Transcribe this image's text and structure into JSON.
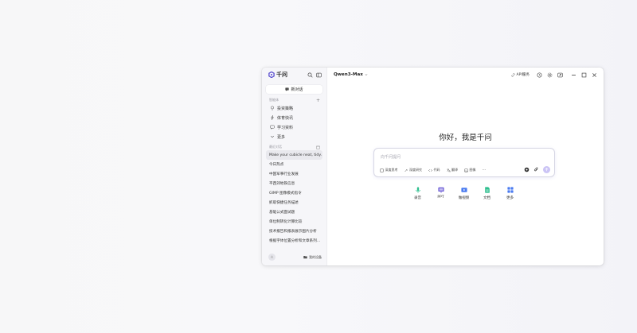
{
  "app": {
    "logo_text": "千问"
  },
  "sidebar": {
    "new_chat": "新对话",
    "agents_header": "智能体",
    "agents": [
      {
        "label": "投资策略",
        "icon": "lightbulb-icon"
      },
      {
        "label": "体育快讯",
        "icon": "lightning-icon"
      },
      {
        "label": "学习资料",
        "icon": "chat-bubble-icon"
      },
      {
        "label": "更多",
        "icon": "chevron-down-icon"
      }
    ],
    "history_header": "最近对话",
    "history": [
      "Make your cubicle neat, tidy…",
      "今日热点",
      "中国军事行业发展",
      "平西郊地铁信息",
      "GIMP 图像模式指令",
      "抓取快捷任务描述",
      "基础公式面试题",
      "单位制转化计算比较",
      "技术报告和报表展示图片分析",
      "根据字体位置分析和文章系列…"
    ],
    "my_devices": "我的设备"
  },
  "header": {
    "model_name": "Qwen3-Max",
    "api_label": "API服务"
  },
  "main": {
    "greeting": "你好，我是千问",
    "input_placeholder": "向千问提问",
    "tools": [
      {
        "label": "深度思考",
        "icon": "atom-icon"
      },
      {
        "label": "深度研究",
        "icon": "telescope-icon"
      },
      {
        "label": "代码",
        "icon": "code-icon"
      },
      {
        "label": "翻译",
        "icon": "translate-icon"
      },
      {
        "label": "图像",
        "icon": "image-icon"
      }
    ],
    "more_label": "···",
    "quick_actions": [
      {
        "label": "录音",
        "icon": "microphone-icon",
        "color": "#2fbf8f"
      },
      {
        "label": "PPT",
        "icon": "ppt-icon",
        "color": "#6b5bd6"
      },
      {
        "label": "做视频",
        "icon": "video-icon",
        "color": "#4a7bf0"
      },
      {
        "label": "文档",
        "icon": "document-icon",
        "color": "#2fbf8f"
      },
      {
        "label": "更多",
        "icon": "grid-icon",
        "color": "#4a7bf0"
      }
    ]
  },
  "colors": {
    "accent": "#6b5bd6",
    "send_button": "#cbc4f5"
  }
}
